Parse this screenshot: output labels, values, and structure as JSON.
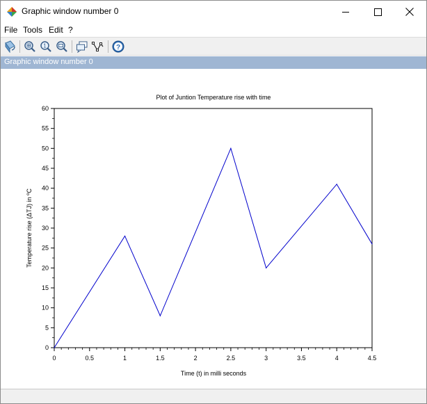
{
  "window": {
    "title": "Graphic window number 0",
    "controls": {
      "minimize": "minimize",
      "maximize": "maximize",
      "close": "close"
    }
  },
  "menu": {
    "items": [
      "File",
      "Tools",
      "Edit",
      "?"
    ]
  },
  "toolbar": {
    "icons": [
      "rotate-tool-icon",
      "zoom-in-icon",
      "zoom-reset-icon",
      "zoom-out-icon",
      "datatip-icon",
      "edit-curve-icon",
      "help-icon"
    ]
  },
  "infobar": {
    "text": "Graphic window number 0"
  },
  "chart_data": {
    "type": "line",
    "title": "Plot of Juntion Temperature rise with time",
    "xlabel": "Time (t) in milli seconds",
    "ylabel": "Temperature rise (ΔTJ) in ºC",
    "xlim": [
      0,
      4.5
    ],
    "ylim": [
      0,
      60
    ],
    "xticks": [
      "0",
      "0.5",
      "1",
      "1.5",
      "2",
      "2.5",
      "3",
      "3.5",
      "4",
      "4.5"
    ],
    "yticks": [
      "0",
      "5",
      "10",
      "15",
      "20",
      "25",
      "30",
      "35",
      "40",
      "45",
      "50",
      "55",
      "60"
    ],
    "grid": false,
    "series": [
      {
        "color": "#0000cc",
        "x": [
          0,
          1,
          1.5,
          2.5,
          3,
          4,
          4.5
        ],
        "y": [
          0,
          28,
          8,
          50,
          20,
          41,
          26
        ]
      }
    ]
  }
}
